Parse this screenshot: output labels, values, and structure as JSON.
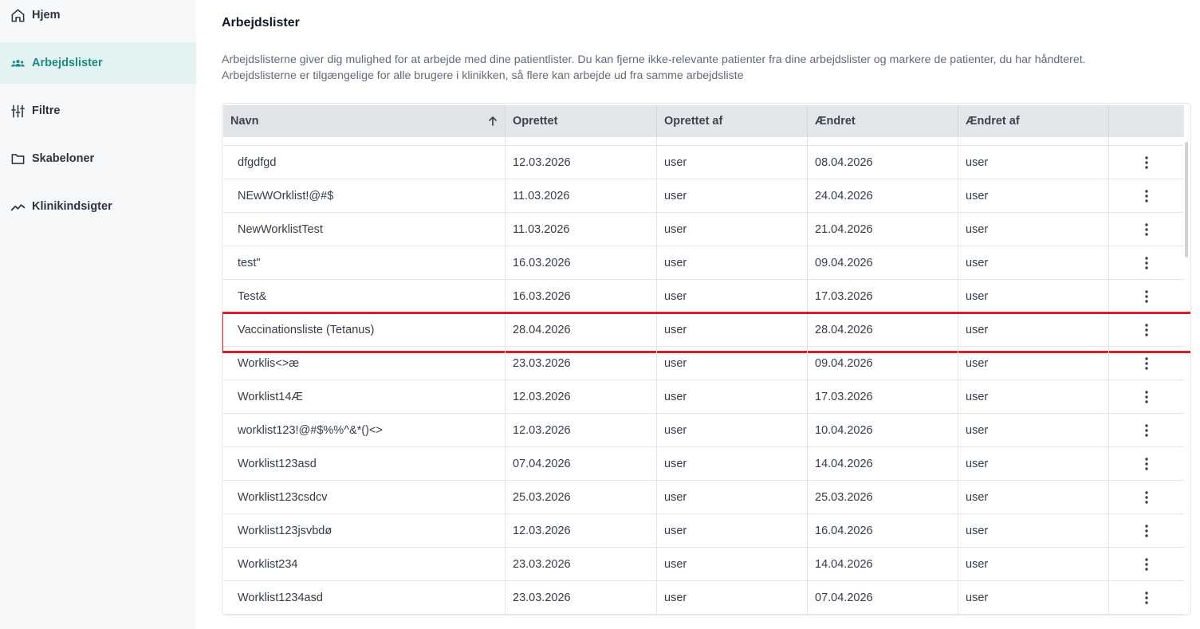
{
  "sidebar": {
    "items": [
      {
        "label": "Hjem",
        "icon": "home-icon",
        "active": false
      },
      {
        "label": "Arbejdslister",
        "icon": "users-group-icon",
        "active": true
      },
      {
        "label": "Filtre",
        "icon": "sliders-icon",
        "active": false
      },
      {
        "label": "Skabeloner",
        "icon": "folder-icon",
        "active": false
      },
      {
        "label": "Klinikindsigter",
        "icon": "trend-chart-icon",
        "active": false
      }
    ]
  },
  "page": {
    "title": "Arbejdslister",
    "description_line1": "Arbejdslisterne giver dig mulighed for at arbejde med dine patientlister. Du kan fjerne ikke-relevante patienter fra dine arbejdslister og markere de patienter, du har håndteret.",
    "description_line2": "Arbejdslisterne er tilgængelige for alle brugere i klinikken, så flere kan arbejde ud fra samme arbejdsliste"
  },
  "table": {
    "columns": [
      "Navn",
      "Oprettet",
      "Oprettet af",
      "Ændret",
      "Ændret af",
      ""
    ],
    "sort_column": "Navn",
    "sort_direction": "ascending",
    "rows": [
      {
        "name": "dfgdfgd",
        "created": "12.03.2026",
        "created_by": "user",
        "changed": "08.04.2026",
        "changed_by": "user"
      },
      {
        "name": "NEwWOrklist!@#$",
        "created": "11.03.2026",
        "created_by": "user",
        "changed": "24.04.2026",
        "changed_by": "user"
      },
      {
        "name": "NewWorklistTest",
        "created": "11.03.2026",
        "created_by": "user",
        "changed": "21.04.2026",
        "changed_by": "user"
      },
      {
        "name": "test\"",
        "created": "16.03.2026",
        "created_by": "user",
        "changed": "09.04.2026",
        "changed_by": "user"
      },
      {
        "name": "Test&",
        "created": "16.03.2026",
        "created_by": "user",
        "changed": "17.03.2026",
        "changed_by": "user"
      },
      {
        "name": "Vaccinationsliste (Tetanus)",
        "created": "28.04.2026",
        "created_by": "user",
        "changed": "28.04.2026",
        "changed_by": "user",
        "highlighted": true
      },
      {
        "name": "Worklis<>æ",
        "created": "23.03.2026",
        "created_by": "user",
        "changed": "09.04.2026",
        "changed_by": "user"
      },
      {
        "name": "Worklist14Æ",
        "created": "12.03.2026",
        "created_by": "user",
        "changed": "17.03.2026",
        "changed_by": "user"
      },
      {
        "name": "worklist123!@#$%%^&*()<>",
        "created": "12.03.2026",
        "created_by": "user",
        "changed": "10.04.2026",
        "changed_by": "user"
      },
      {
        "name": "Worklist123asd",
        "created": "07.04.2026",
        "created_by": "user",
        "changed": "14.04.2026",
        "changed_by": "user"
      },
      {
        "name": "Worklist123csdcv",
        "created": "25.03.2026",
        "created_by": "user",
        "changed": "25.03.2026",
        "changed_by": "user"
      },
      {
        "name": "Worklist123jsvbdø",
        "created": "12.03.2026",
        "created_by": "user",
        "changed": "16.04.2026",
        "changed_by": "user"
      },
      {
        "name": "Worklist234",
        "created": "23.03.2026",
        "created_by": "user",
        "changed": "14.04.2026",
        "changed_by": "user"
      },
      {
        "name": "Worklist1234asd",
        "created": "23.03.2026",
        "created_by": "user",
        "changed": "07.04.2026",
        "changed_by": "user"
      }
    ]
  },
  "colors": {
    "accent": "#1e8a85",
    "active_bg": "#e3f3f1",
    "highlight_border": "#dc1f26"
  }
}
